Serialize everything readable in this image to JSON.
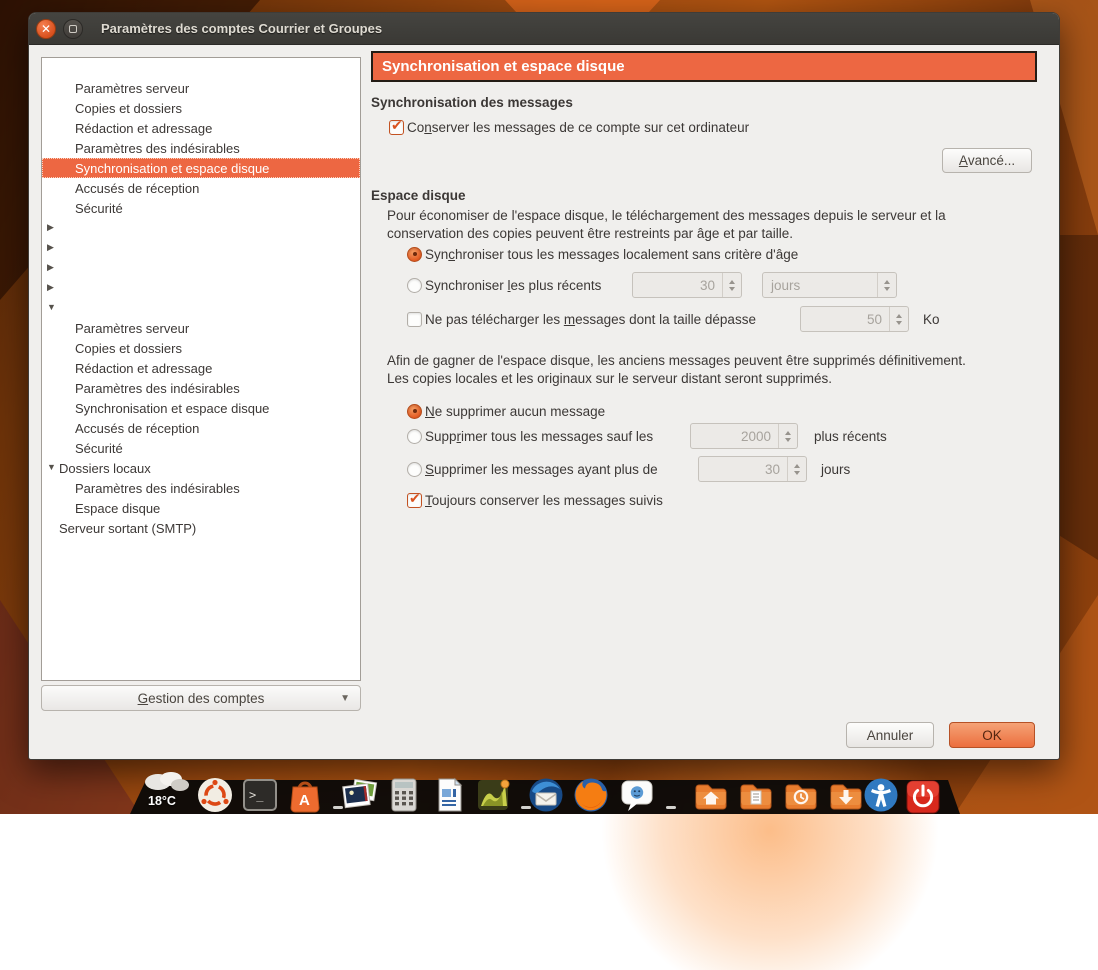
{
  "window": {
    "title": "Paramètres des comptes Courrier et Groupes",
    "controls": {
      "close": "close",
      "maximize": "maximize"
    }
  },
  "sidebar": {
    "tree": [
      {
        "label": "",
        "level": 0,
        "arrow": "none",
        "name": "account"
      },
      {
        "label": "Paramètres serveur",
        "level": 1
      },
      {
        "label": "Copies et dossiers",
        "level": 1
      },
      {
        "label": "Rédaction et adressage",
        "level": 1
      },
      {
        "label": "Paramètres des indésirables",
        "level": 1
      },
      {
        "label": "Synchronisation et espace disque",
        "level": 1,
        "selected": true
      },
      {
        "label": "Accusés de réception",
        "level": 1
      },
      {
        "label": "Sécurité",
        "level": 1
      },
      {
        "label": "",
        "level": 0,
        "arrow": "collapsed",
        "name": "account"
      },
      {
        "label": "",
        "level": 0,
        "arrow": "collapsed",
        "name": "account"
      },
      {
        "label": "",
        "level": 0,
        "arrow": "collapsed",
        "name": "account"
      },
      {
        "label": "",
        "level": 0,
        "arrow": "collapsed",
        "name": "account"
      },
      {
        "label": "",
        "level": 0,
        "arrow": "expanded",
        "name": "account"
      },
      {
        "label": "Paramètres serveur",
        "level": 1
      },
      {
        "label": "Copies et dossiers",
        "level": 1
      },
      {
        "label": "Rédaction et adressage",
        "level": 1
      },
      {
        "label": "Paramètres des indésirables",
        "level": 1
      },
      {
        "label": "Synchronisation et espace disque",
        "level": 1
      },
      {
        "label": "Accusés de réception",
        "level": 1
      },
      {
        "label": "Sécurité",
        "level": 1
      },
      {
        "label": "Dossiers locaux",
        "level": 0,
        "arrow": "expanded"
      },
      {
        "label": "Paramètres des indésirables",
        "level": 1
      },
      {
        "label": "Espace disque",
        "level": 1
      },
      {
        "label": "Serveur sortant (SMTP)",
        "level": 0,
        "arrow": "none"
      }
    ],
    "manage_button": {
      "label": "Gestion des comptes",
      "mnemonic_index": 0
    }
  },
  "panel": {
    "header": "Synchronisation et espace disque",
    "sync_section": {
      "heading": "Synchronisation des messages",
      "keep_checkbox": {
        "type": "checkbox",
        "checked": true,
        "label": "Conserver les messages de ce compte sur cet ordinateur",
        "mnemonic_index": 2
      },
      "advanced_button": {
        "label": "Avancé...",
        "mnemonic_index": 0
      }
    },
    "disk_section": {
      "heading": "Espace disque",
      "intro": [
        "Pour économiser de l'espace disque, le téléchargement des messages depuis le serveur et la",
        "conservation des copies peuvent être restreints par âge et par taille."
      ],
      "rows": [
        {
          "type": "radio",
          "checked": true,
          "label": "Synchroniser tous les messages localement sans critère d'âge",
          "mnemonic_index": 3
        },
        {
          "type": "radio",
          "checked": false,
          "label": "Synchroniser les plus récents",
          "mnemonic_index": 13,
          "field": {
            "value": "30"
          },
          "select": {
            "value": "jours"
          }
        },
        {
          "type": "checkbox",
          "checked": false,
          "label": "Ne pas télécharger les messages dont la taille dépasse",
          "mnemonic_index": 23,
          "field": {
            "value": "50"
          },
          "suffix": "Ko"
        }
      ],
      "intro2": [
        "Afin de gagner de l'espace disque, les anciens messages peuvent être supprimés définitivement.",
        "Les copies locales et les originaux sur le serveur distant seront supprimés."
      ],
      "rows2": [
        {
          "type": "radio",
          "checked": true,
          "label": "Ne supprimer aucun message",
          "mnemonic_index": 0
        },
        {
          "type": "radio",
          "checked": false,
          "label": "Supprimer tous les messages sauf les",
          "mnemonic_index": 4,
          "field": {
            "value": "2000"
          },
          "suffix": "plus récents"
        },
        {
          "type": "radio",
          "checked": false,
          "label": "Supprimer les messages ayant plus de",
          "mnemonic_index": 0,
          "field": {
            "value": "30"
          },
          "suffix": "jours"
        },
        {
          "type": "checkbox",
          "checked": true,
          "label": "Toujours conserver les messages suivis",
          "mnemonic_index": 0
        }
      ]
    },
    "footer": {
      "cancel": "Annuler",
      "ok": "OK"
    }
  },
  "dock": {
    "weather": {
      "temp": "18°C"
    },
    "icons": [
      "ubuntu-dash-icon",
      "terminal-icon",
      "software-center-icon",
      "photos-icon",
      "calculator-icon",
      "libreoffice-writer-icon",
      "gimp-icon",
      "thunderbird-icon",
      "firefox-icon",
      "messenger-icon",
      "home-folder-icon",
      "documents-folder-icon",
      "backup-folder-icon",
      "downloads-folder-icon",
      "accessibility-icon",
      "power-icon"
    ]
  },
  "colors": {
    "accent": "#ED6742",
    "titlebar": "#3C3B37",
    "ok_button": "#EC6F3E"
  }
}
